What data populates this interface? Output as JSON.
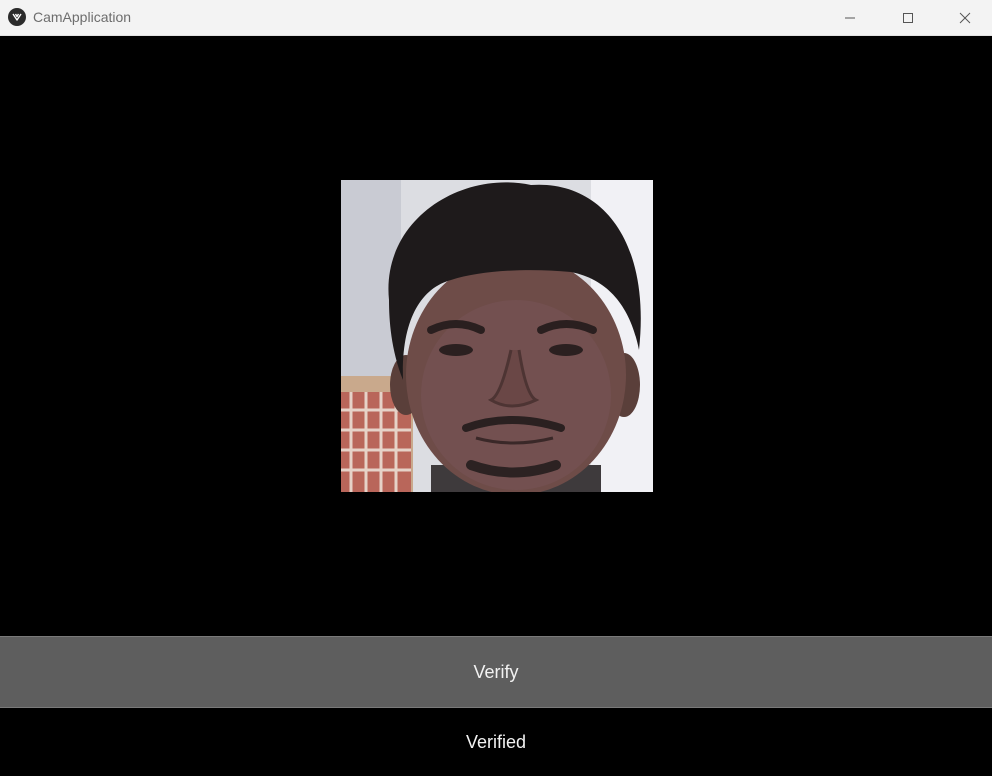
{
  "window": {
    "title": "CamApplication",
    "icons": {
      "app": "kivy-logo-icon",
      "minimize": "minimize-icon",
      "maximize": "maximize-icon",
      "close": "close-icon"
    }
  },
  "camera": {
    "feed": "webcam-face-feed"
  },
  "controls": {
    "verify_label": "Verify"
  },
  "status": {
    "text": "Verified"
  },
  "colors": {
    "titlebar_bg": "#f3f3f3",
    "app_bg": "#000000",
    "button_bg": "#5e5e5e",
    "text": "#f2f2f2"
  }
}
